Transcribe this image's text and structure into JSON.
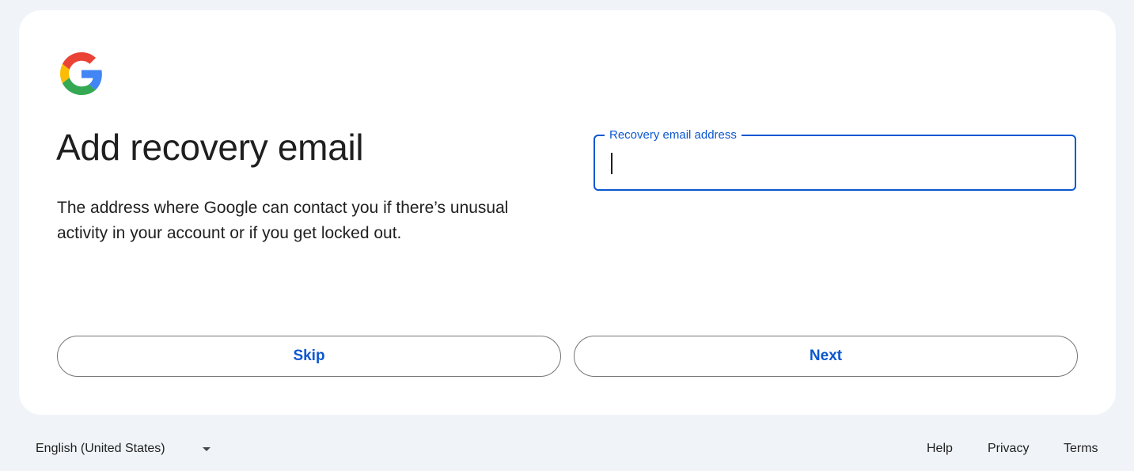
{
  "page": {
    "title": "Add recovery email",
    "description": "The address where Google can contact you if there’s unusual activity in your account or if you get locked out."
  },
  "field": {
    "label": "Recovery email address",
    "value": ""
  },
  "buttons": {
    "skip": "Skip",
    "next": "Next"
  },
  "footer": {
    "language": "English (United States)",
    "links": [
      "Help",
      "Privacy",
      "Terms"
    ]
  },
  "colors": {
    "accent": "#0b57d0",
    "background": "#f0f4f9",
    "card": "#ffffff",
    "text": "#1f1f1f"
  },
  "icons": {
    "logo": "google-g-icon",
    "language_dropdown": "caret-down-icon"
  }
}
